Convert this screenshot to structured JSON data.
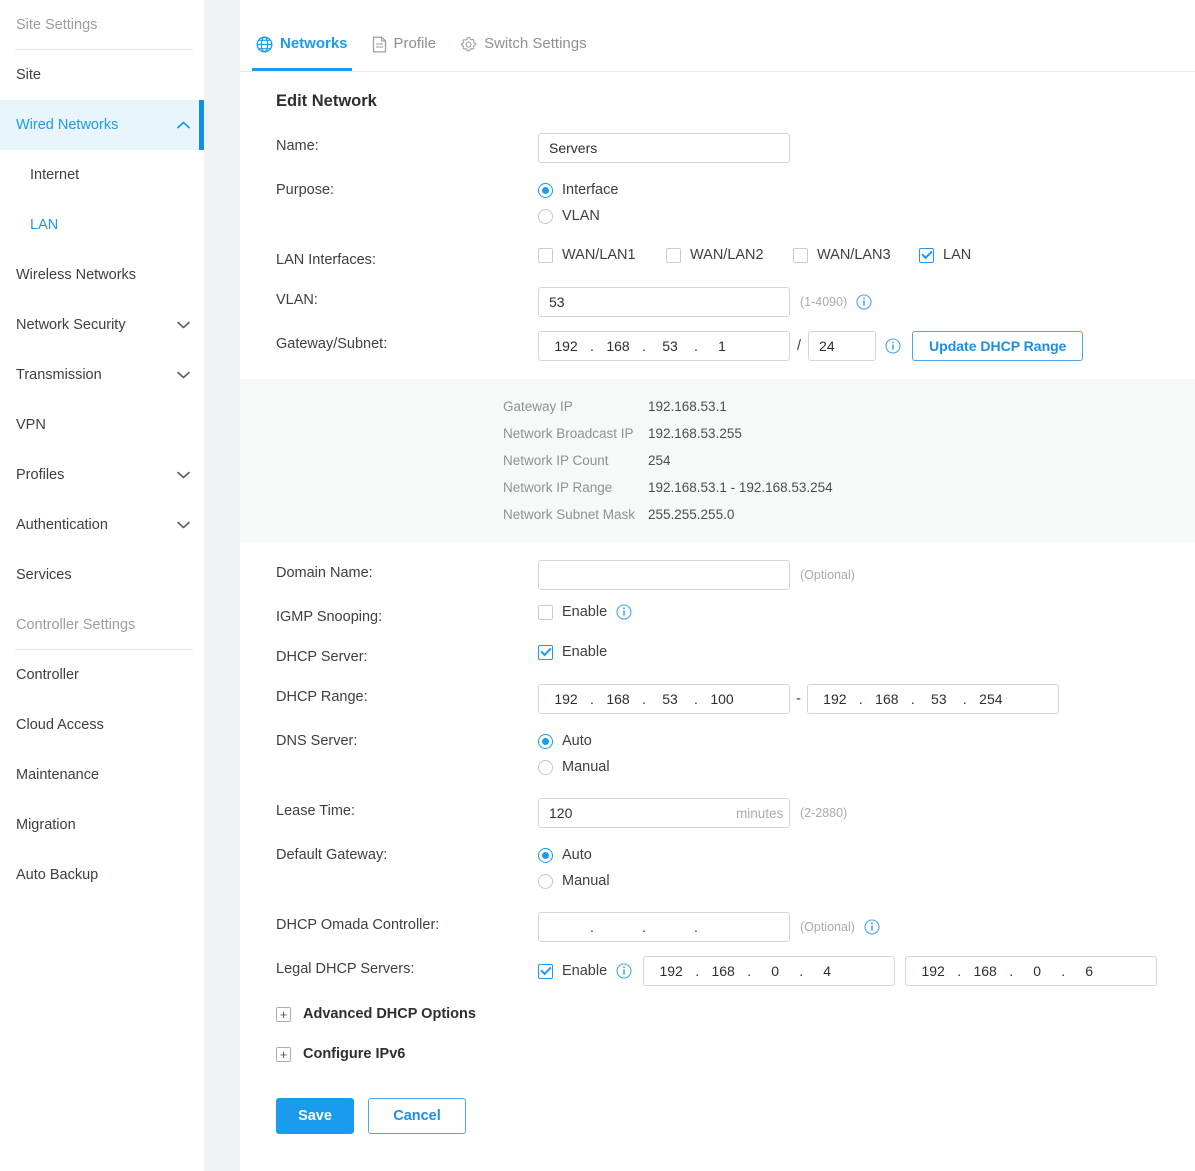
{
  "sidebar": {
    "sections": [
      {
        "title": "Site Settings",
        "items": [
          {
            "label": "Site",
            "type": "item",
            "state": "normal",
            "chevron": "none"
          },
          {
            "label": "Wired Networks",
            "type": "item",
            "state": "active",
            "chevron": "up"
          },
          {
            "label": "Internet",
            "type": "sub",
            "state": "normal"
          },
          {
            "label": "LAN",
            "type": "sub",
            "state": "selected"
          },
          {
            "label": "Wireless Networks",
            "type": "item",
            "state": "normal",
            "chevron": "none"
          },
          {
            "label": "Network Security",
            "type": "item",
            "state": "normal",
            "chevron": "down"
          },
          {
            "label": "Transmission",
            "type": "item",
            "state": "normal",
            "chevron": "down"
          },
          {
            "label": "VPN",
            "type": "item",
            "state": "normal",
            "chevron": "none"
          },
          {
            "label": "Profiles",
            "type": "item",
            "state": "normal",
            "chevron": "down"
          },
          {
            "label": "Authentication",
            "type": "item",
            "state": "normal",
            "chevron": "down"
          },
          {
            "label": "Services",
            "type": "item",
            "state": "normal",
            "chevron": "none"
          }
        ]
      },
      {
        "title": "Controller Settings",
        "items": [
          {
            "label": "Controller",
            "type": "item",
            "state": "normal",
            "chevron": "none"
          },
          {
            "label": "Cloud Access",
            "type": "item",
            "state": "normal",
            "chevron": "none"
          },
          {
            "label": "Maintenance",
            "type": "item",
            "state": "normal",
            "chevron": "none"
          },
          {
            "label": "Migration",
            "type": "item",
            "state": "normal",
            "chevron": "none"
          },
          {
            "label": "Auto Backup",
            "type": "item",
            "state": "normal",
            "chevron": "none"
          }
        ]
      }
    ]
  },
  "tabs": [
    {
      "label": "Networks",
      "icon": "globe-icon",
      "active": true
    },
    {
      "label": "Profile",
      "icon": "document-icon",
      "active": false
    },
    {
      "label": "Switch Settings",
      "icon": "gear-icon",
      "active": false
    }
  ],
  "form": {
    "title": "Edit Network",
    "name": {
      "label": "Name:",
      "value": "Servers",
      "placeholder": ""
    },
    "purpose": {
      "label": "Purpose:",
      "options": [
        {
          "label": "Interface",
          "selected": true
        },
        {
          "label": "VLAN",
          "selected": false
        }
      ]
    },
    "lan_interfaces": {
      "label": "LAN Interfaces:",
      "options": [
        {
          "label": "WAN/LAN1",
          "checked": false
        },
        {
          "label": "WAN/LAN2",
          "checked": false
        },
        {
          "label": "WAN/LAN3",
          "checked": false
        },
        {
          "label": "LAN",
          "checked": true
        }
      ]
    },
    "vlan": {
      "label": "VLAN:",
      "value": "53",
      "hint": "(1-4090)",
      "info": "info-icon"
    },
    "gateway_subnet": {
      "label": "Gateway/Subnet:",
      "ip": [
        "192",
        "168",
        "53",
        "1"
      ],
      "separator": "/",
      "prefix": "24",
      "info": "info-icon",
      "button": "Update DHCP Range"
    },
    "info_panel": {
      "rows": [
        {
          "key": "Gateway IP",
          "value": "192.168.53.1"
        },
        {
          "key": "Network Broadcast IP",
          "value": "192.168.53.255"
        },
        {
          "key": "Network IP Count",
          "value": "254"
        },
        {
          "key": "Network IP Range",
          "value": "192.168.53.1 - 192.168.53.254"
        },
        {
          "key": "Network Subnet Mask",
          "value": "255.255.255.0"
        }
      ]
    },
    "domain_name": {
      "label": "Domain Name:",
      "value": "",
      "placeholder": "",
      "hint": "(Optional)"
    },
    "igmp_snooping": {
      "label": "IGMP Snooping:",
      "checkbox_label": "Enable",
      "checked": false,
      "info": "info-icon"
    },
    "dhcp_server": {
      "label": "DHCP Server:",
      "checkbox_label": "Enable",
      "checked": true
    },
    "dhcp_range": {
      "label": "DHCP Range:",
      "start": [
        "192",
        "168",
        "53",
        "100"
      ],
      "separator": "-",
      "end": [
        "192",
        "168",
        "53",
        "254"
      ]
    },
    "dns_server": {
      "label": "DNS Server:",
      "options": [
        {
          "label": "Auto",
          "selected": true
        },
        {
          "label": "Manual",
          "selected": false
        }
      ]
    },
    "lease_time": {
      "label": "Lease Time:",
      "value": "120",
      "unit": "minutes",
      "hint": "(2-2880)"
    },
    "default_gateway": {
      "label": "Default Gateway:",
      "options": [
        {
          "label": "Auto",
          "selected": true
        },
        {
          "label": "Manual",
          "selected": false
        }
      ]
    },
    "dhcp_omada_controller": {
      "label": "DHCP Omada Controller:",
      "ip": [
        "",
        "",
        "",
        ""
      ],
      "hint": "(Optional)",
      "info": "info-icon"
    },
    "legal_dhcp_servers": {
      "label": "Legal DHCP Servers:",
      "checkbox_label": "Enable",
      "checked": true,
      "info": "info-icon",
      "server1": [
        "192",
        "168",
        "0",
        "4"
      ],
      "server2": [
        "192",
        "168",
        "0",
        "6"
      ]
    },
    "expanders": [
      {
        "label": "Advanced DHCP Options",
        "glyph": "+"
      },
      {
        "label": "Configure IPv6",
        "glyph": "+"
      }
    ],
    "footer": {
      "save_label": "Save",
      "cancel_label": "Cancel"
    }
  },
  "colors": {
    "accent": "#1a9bed",
    "accent_dark": "#0e90e4",
    "active_bg": "#e9f5fd",
    "panel_bg": "#f7f8f8",
    "page_bg": "#f0f1f3",
    "text": "#3c4043",
    "muted": "#a8abaf"
  }
}
